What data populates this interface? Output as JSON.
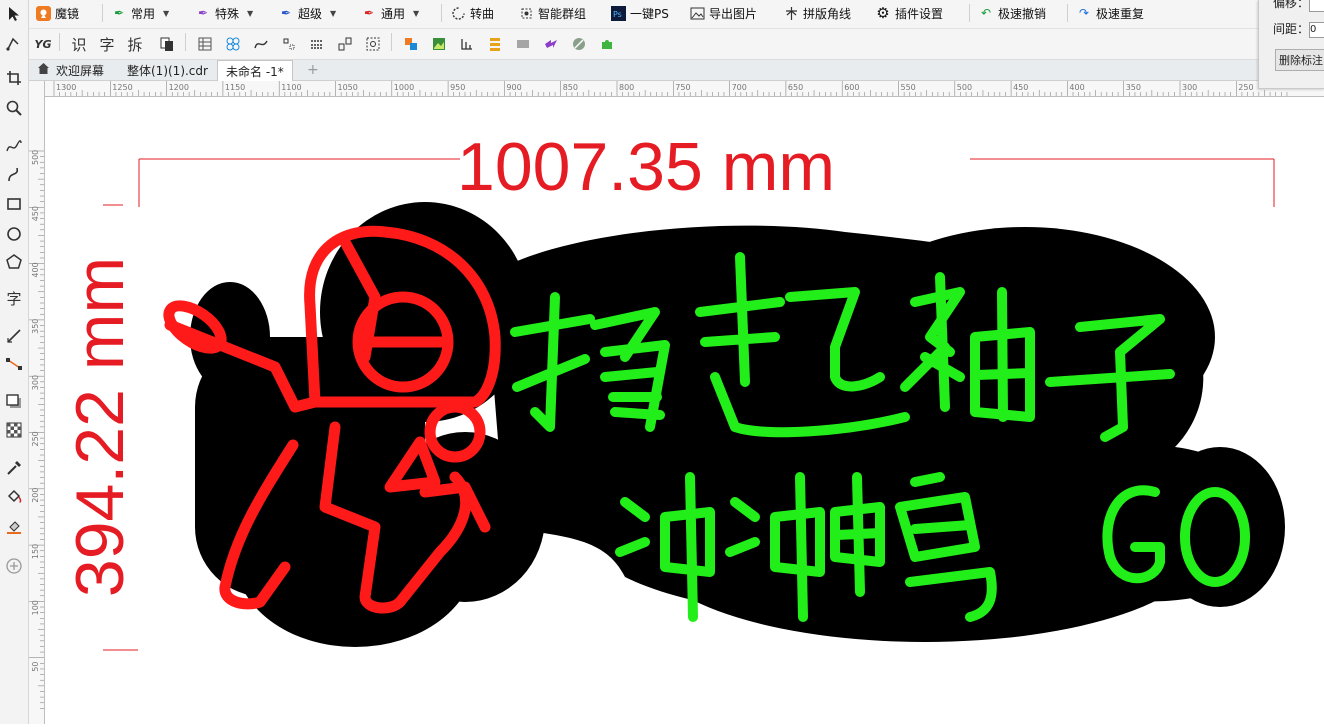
{
  "toolbar": {
    "items": [
      "魔镜",
      "常用",
      "特殊",
      "超级",
      "通用",
      "转曲",
      "智能群组",
      "一键PS",
      "导出图片",
      "拼版角线",
      "插件设置",
      "极速撤销",
      "极速重复"
    ]
  },
  "toolbar2": {
    "text_tools": [
      "识",
      "字",
      "拆"
    ]
  },
  "tabs": [
    "欢迎屏幕",
    "整体(1)(1).cdr",
    "未命名 -1*"
  ],
  "ruler": {
    "h_ticks": [
      "1300",
      "1250",
      "1200",
      "1150",
      "1100",
      "1050",
      "1000",
      "950",
      "900",
      "850",
      "800",
      "750",
      "700",
      "650",
      "600",
      "550",
      "500",
      "450",
      "400",
      "350",
      "300",
      "250"
    ],
    "v_ticks": [
      "500",
      "450",
      "400",
      "350",
      "300",
      "250",
      "200",
      "150",
      "100",
      "50"
    ]
  },
  "dock": {
    "offset_label": "偏移：",
    "spacing_label": "间距：",
    "spacing_value": "0",
    "delete_button": "删除标注"
  },
  "drawing": {
    "width_dim": "1007.35 mm",
    "height_dim": "394.22 mm",
    "line1": "撸起袖子",
    "line2": "冲冲鸭",
    "line2_suffix": "GO",
    "colors": {
      "dimension": "#e51c23",
      "neon_red": "#ff1a1a",
      "neon_green": "#22ee1a",
      "backing": "#000000"
    }
  }
}
